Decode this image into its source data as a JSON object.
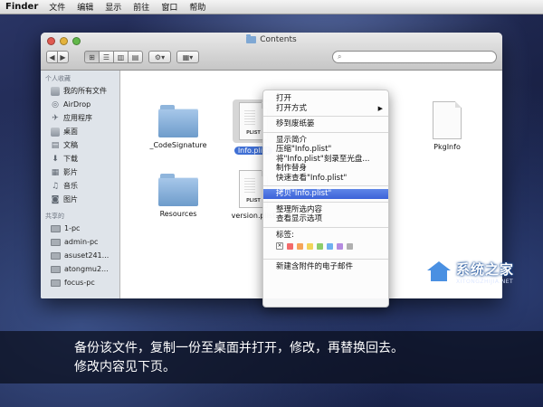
{
  "menubar": {
    "app": "Finder",
    "items": [
      "文件",
      "编辑",
      "显示",
      "前往",
      "窗口",
      "帮助"
    ]
  },
  "window": {
    "title": "Contents",
    "search_placeholder": ""
  },
  "toolbar": {
    "back": "◀",
    "forward": "▶",
    "views": [
      "⊞",
      "☰",
      "▥",
      "▤"
    ],
    "action": "⚙▾",
    "arrange": "▦▾"
  },
  "sidebar": {
    "favorites_header": "个人收藏",
    "favorites": [
      {
        "label": "我的所有文件",
        "icon": "all-files-icon"
      },
      {
        "label": "AirDrop",
        "icon": "airdrop-icon"
      },
      {
        "label": "应用程序",
        "icon": "applications-icon"
      },
      {
        "label": "桌面",
        "icon": "desktop-icon"
      },
      {
        "label": "文稿",
        "icon": "documents-icon"
      },
      {
        "label": "下载",
        "icon": "downloads-icon"
      },
      {
        "label": "影片",
        "icon": "movies-icon"
      },
      {
        "label": "音乐",
        "icon": "music-icon"
      },
      {
        "label": "图片",
        "icon": "pictures-icon"
      }
    ],
    "shared_header": "共享的",
    "shared": [
      "1-pc",
      "admin-pc",
      "asuset241...",
      "atongmu2...",
      "focus-pc"
    ]
  },
  "files": [
    {
      "name": "_CodeSignature",
      "kind": "folder"
    },
    {
      "name": "Info.plist",
      "kind": "plist",
      "badge": "PLIST",
      "selected": true
    },
    {
      "name": "PkgInfo",
      "kind": "doc"
    },
    {
      "name": "Resources",
      "kind": "folder"
    },
    {
      "name": "version.plist",
      "kind": "plist",
      "badge": "PLIST"
    }
  ],
  "context_menu": {
    "open": "打开",
    "open_with": "打开方式",
    "trash": "移到废纸篓",
    "get_info": "显示简介",
    "compress": "压缩\"Info.plist\"",
    "burn": "将\"Info.plist\"刻录至光盘...",
    "alias": "制作替身",
    "quicklook": "快速查看\"Info.plist\"",
    "copy": "拷贝\"Info.plist\"",
    "clean_up": "整理所选内容",
    "view_options": "查看显示选项",
    "tags_label": "标签:",
    "tag_colors": [
      "#f36a6a",
      "#f5a55a",
      "#f1d45a",
      "#8ccd6b",
      "#6fb0f0",
      "#b58be0",
      "#b0b0b0"
    ],
    "new_email": "新建含附件的电子邮件"
  },
  "watermark": {
    "title": "系统之家",
    "subtitle": "XITONGZHIJIA.NET"
  },
  "caption": {
    "line1": "备份该文件，复制一份至桌面并打开，修改，再替换回去。",
    "line2": "修改内容见下页。"
  }
}
